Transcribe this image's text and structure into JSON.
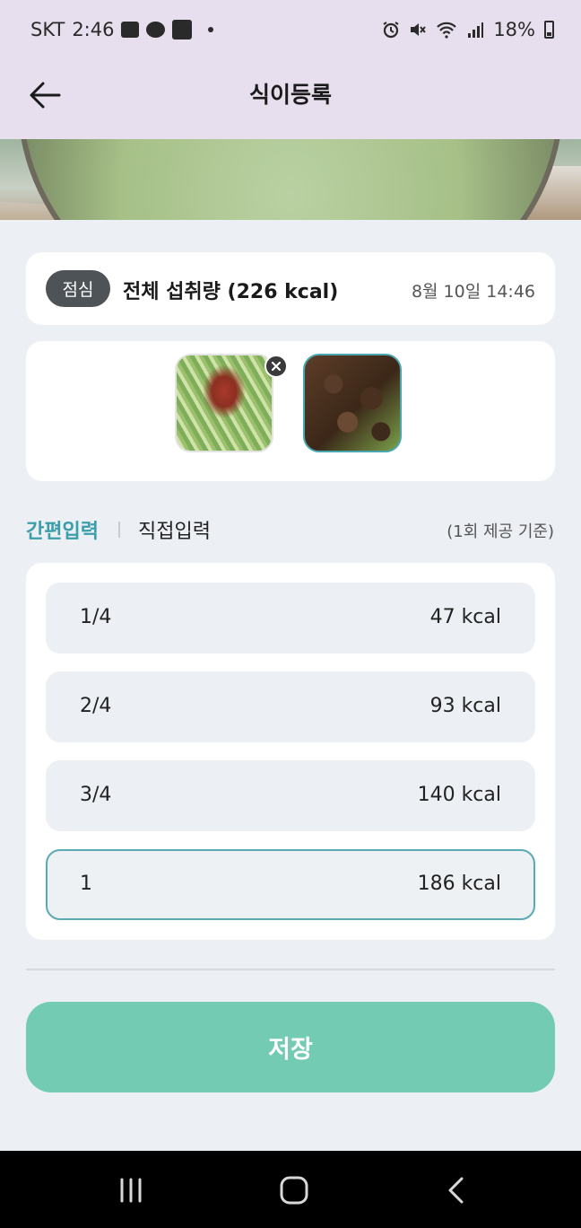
{
  "status_bar": {
    "carrier": "SKT",
    "time": "2:46",
    "battery": "18%"
  },
  "header": {
    "title": "식이등록"
  },
  "meal": {
    "badge": "점심",
    "total": "전체 섭취량 (226 kcal)",
    "date": "8월 10일  14:46"
  },
  "input_tabs": {
    "simple": "간편입력",
    "manual": "직접입력",
    "serving_note": "(1회 제공 기준)"
  },
  "portions": [
    {
      "label": "1/4",
      "kcal": "47 kcal",
      "selected": false
    },
    {
      "label": "2/4",
      "kcal": "93 kcal",
      "selected": false
    },
    {
      "label": "3/4",
      "kcal": "140 kcal",
      "selected": false
    },
    {
      "label": "1",
      "kcal": "186 kcal",
      "selected": true
    }
  ],
  "save_button": "저장",
  "colors": {
    "accent": "#3a9eab",
    "save": "#74cbb3",
    "header_bg": "#e7deee",
    "badge_bg": "#4e5358"
  }
}
